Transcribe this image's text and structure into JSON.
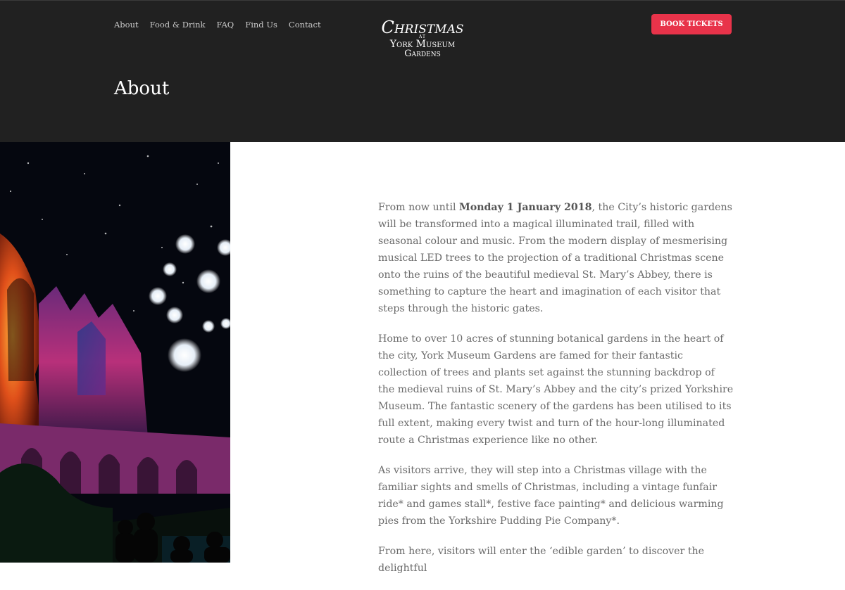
{
  "nav": {
    "items": [
      "About",
      "Food & Drink",
      "FAQ",
      "Find Us",
      "Contact"
    ]
  },
  "logo": {
    "line1": "Christmas",
    "line2": "AT",
    "line3": "York Museum",
    "line4": "Gardens"
  },
  "header": {
    "book_label": "BOOK TICKETS",
    "page_title": "About"
  },
  "hero": {
    "image_description_icon": "abbey-ruins-illuminated-image"
  },
  "content": {
    "p1_pre": "From now until ",
    "p1_bold": "Monday 1 January 2018",
    "p1_post": ", the City’s historic gardens will be transformed into a magical illuminated trail, filled with seasonal colour and music. From the modern display of mesmerising musical LED trees to the projection of a traditional Christmas scene onto the ruins of the beautiful medieval St. Mary’s Abbey, there is something to capture the heart and imagination of each visitor that steps through the historic gates.",
    "p2": "Home to over 10 acres of stunning botanical gardens in the heart of the city, York Museum Gardens are famed for their fantastic collection of trees and plants set against the stunning backdrop of the medieval ruins of St. Mary’s Abbey and the city’s prized Yorkshire Museum. The fantastic scenery of the gardens has been utilised to its full extent, making every twist and turn of the hour-long illuminated route a Christmas experience like no other.",
    "p3": "As visitors arrive, they will step into a Christmas village with the familiar sights and smells of Christmas, including a vintage funfair ride* and games stall*, festive face painting* and delicious warming pies from the Yorkshire Pudding Pie Company*.",
    "p4": "From here, visitors will enter the ‘edible garden’ to discover the delightful"
  },
  "colors": {
    "header_bg": "#212121",
    "accent": "#e8334a",
    "body_text": "#6a6a6a"
  }
}
